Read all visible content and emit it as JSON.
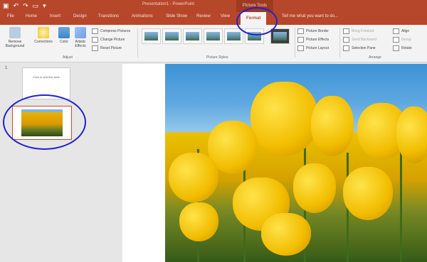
{
  "titlebar": {
    "qat_icons": [
      "save-icon",
      "undo-icon",
      "redo-icon",
      "present-icon",
      "customize-icon"
    ],
    "title": "Presentation1 - PowerPoint",
    "context_tools": "Picture Tools"
  },
  "tabs": [
    "File",
    "Home",
    "Insert",
    "Design",
    "Transitions",
    "Animations",
    "Slide Show",
    "Review",
    "View",
    "Format",
    "Tell me what you want to do..."
  ],
  "ribbon": {
    "adjust": {
      "remove_bg": "Remove Background",
      "corrections": "Corrections",
      "color": "Color",
      "artistic": "Artistic Effects",
      "compress": "Compress Pictures",
      "change": "Change Picture",
      "reset": "Reset Picture",
      "group_label": "Adjust"
    },
    "styles": {
      "group_label": "Picture Styles"
    },
    "picture": {
      "border": "Picture Border",
      "effects": "Picture Effects",
      "layout": "Picture Layout"
    },
    "arrange": {
      "bring_forward": "Bring Forward",
      "send_backward": "Send Backward",
      "selection_pane": "Selection Pane",
      "align": "Align",
      "group": "Group",
      "rotate": "Rotate",
      "group_label": "Arrange"
    }
  },
  "slides": {
    "first_number": "1",
    "first_text": "Click to add first slide"
  },
  "colors": {
    "accent": "#b7472a",
    "annotation": "#2222cc"
  }
}
